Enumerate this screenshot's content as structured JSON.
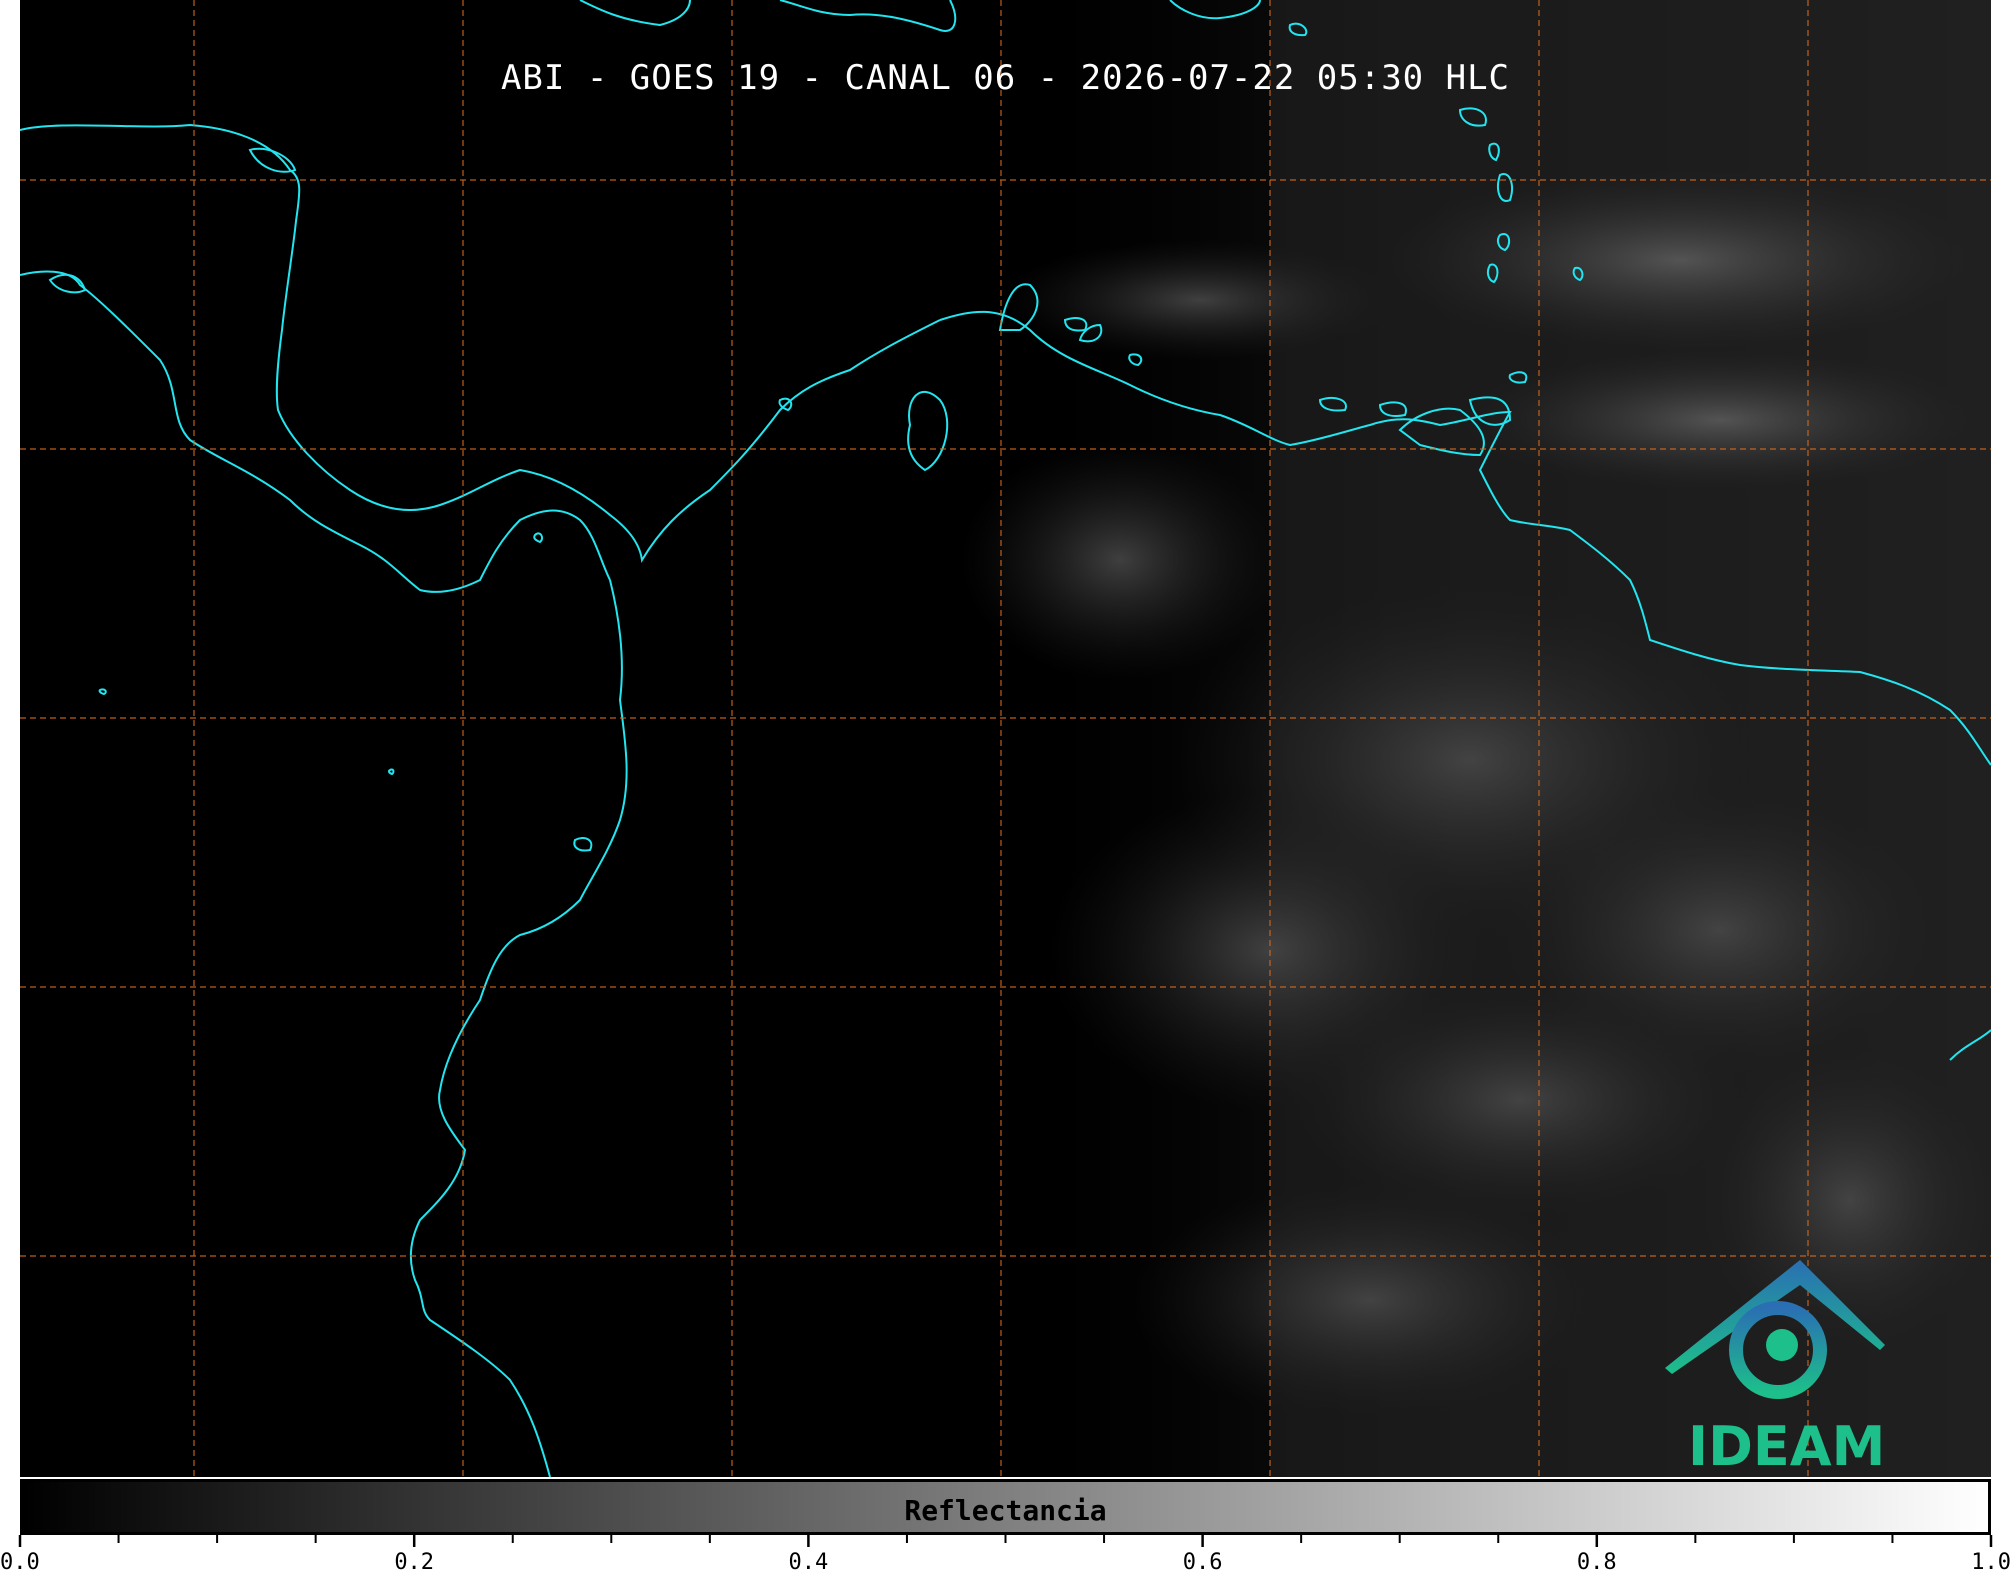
{
  "map": {
    "title": "ABI - GOES 19 - CANAL 06 - 2026-07-22 05:30 HLC",
    "coastline_color": "#22e5ef",
    "grid_color": "#d2691e",
    "background_color": "#000000",
    "logo": {
      "text": "IDEAM",
      "color_top": "#2a6fb3",
      "color_bottom": "#1dbf8a"
    }
  },
  "colorbar": {
    "label": "Reflectancia",
    "colormap": "gray",
    "range": [
      0.0,
      1.0
    ],
    "tick_labels": [
      "0.0",
      "0.2",
      "0.4",
      "0.6",
      "0.8",
      "1.0"
    ]
  }
}
